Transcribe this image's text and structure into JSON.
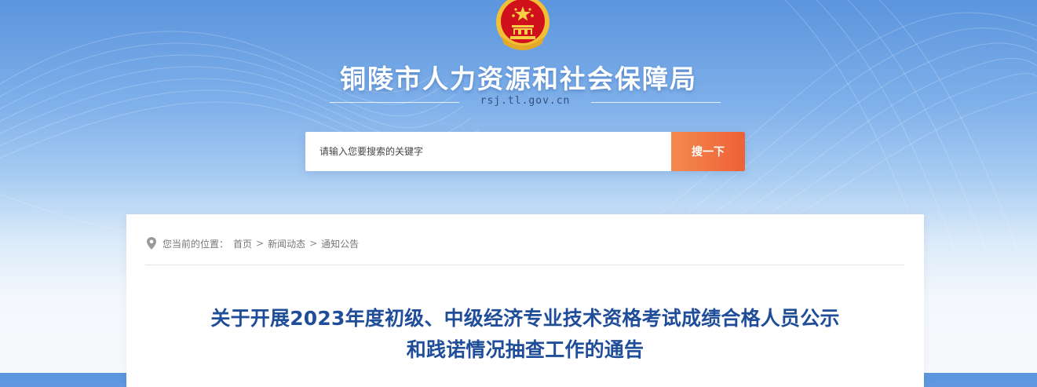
{
  "header": {
    "site_title": "铜陵市人力资源和社会保障局",
    "domain": "rsj.tl.gov.cn",
    "emblem_icon": "national-emblem-icon"
  },
  "search": {
    "placeholder": "请输入您要搜索的关键字",
    "button_label": "搜一下"
  },
  "breadcrumb": {
    "icon": "location-pin-icon",
    "prefix": "您当前的位置：",
    "items": [
      "首页",
      "新闻动态",
      "通知公告"
    ],
    "separator": ">"
  },
  "article": {
    "title_line1": "关于开展2023年度初级、中级经济专业技术资格考试成绩合格人员公示",
    "title_line2": "和践诺情况抽查工作的通告"
  },
  "colors": {
    "title_blue": "#1f4d99",
    "search_orange": "#ee6137",
    "emblem_red": "#d0101a",
    "emblem_gold": "#f2c036"
  }
}
